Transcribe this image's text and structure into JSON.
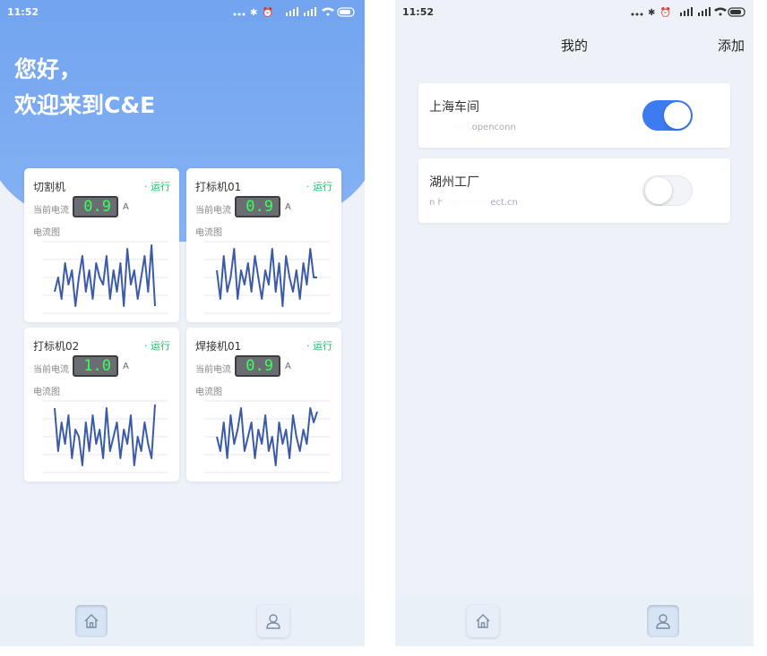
{
  "home": {
    "status_time": "11:52",
    "status_icons": "... ✱ ⏰ 📶 📶 ▭",
    "greeting_line1": "您好，",
    "greeting_line2": "欢迎来到C&E",
    "machines": [
      {
        "name": "切割机",
        "status": "· 运行",
        "current_label": "当前电流",
        "current": "0.9",
        "unit": "A",
        "chart_label": "电流图",
        "wave": [
          0.3,
          0.5,
          0.2,
          0.7,
          0.4,
          0.6,
          0.1,
          0.5,
          0.8,
          0.3,
          0.6,
          0.2,
          0.7,
          0.5,
          0.4,
          0.8,
          0.2,
          0.6,
          0.3,
          0.7,
          0.1,
          0.9,
          0.4,
          0.6,
          0.2,
          0.5,
          0.8,
          0.3,
          0.95,
          0.1
        ]
      },
      {
        "name": "打标机01",
        "status": "· 运行",
        "current_label": "当前电流",
        "current": "0.9",
        "unit": "A",
        "chart_label": "电流图",
        "wave": [
          0.6,
          0.2,
          0.8,
          0.3,
          0.5,
          0.9,
          0.2,
          0.6,
          0.4,
          0.7,
          0.3,
          0.8,
          0.5,
          0.2,
          0.6,
          0.4,
          0.9,
          0.3,
          0.7,
          0.1,
          0.8,
          0.5,
          0.3,
          0.6,
          0.2,
          0.7,
          0.4,
          0.9,
          0.5,
          0.5
        ]
      },
      {
        "name": "打标机02",
        "status": "· 运行",
        "current_label": "当前电流",
        "current": "1.0",
        "unit": "A",
        "chart_label": "电流图",
        "wave": [
          0.9,
          0.3,
          0.7,
          0.4,
          0.8,
          0.2,
          0.6,
          0.5,
          0.1,
          0.7,
          0.3,
          0.8,
          0.4,
          0.6,
          0.2,
          0.9,
          0.3,
          0.5,
          0.7,
          0.2,
          0.6,
          0.4,
          0.8,
          0.1,
          0.5,
          0.3,
          0.7,
          0.4,
          0.2,
          0.95
        ]
      },
      {
        "name": "焊接机01",
        "status": "· 运行",
        "current_label": "当前电流",
        "current": "0.9",
        "unit": "A",
        "chart_label": "电流图",
        "wave": [
          0.5,
          0.3,
          0.7,
          0.2,
          0.8,
          0.4,
          0.6,
          0.9,
          0.3,
          0.5,
          0.7,
          0.2,
          0.6,
          0.4,
          0.8,
          0.3,
          0.5,
          0.1,
          0.7,
          0.4,
          0.6,
          0.2,
          0.8,
          0.5,
          0.3,
          0.6,
          0.4,
          0.9,
          0.7,
          0.85
        ]
      }
    ]
  },
  "mine": {
    "status_time": "11:52",
    "status_icons": "... ✱ ⏰ 📶 📶 ▭",
    "title": "我的",
    "add_label": "添加",
    "workshops": [
      {
        "name": "上海车间",
        "host": "red.openconn",
        "enabled": true
      },
      {
        "name": "湖州工厂",
        "host": "n  h.openconnect.cn",
        "enabled": false
      }
    ]
  },
  "colors": {
    "accent": "#3d7bf0",
    "header": "#6fa1ee",
    "run_green": "#27b86a",
    "lcd_green": "#3aff5a",
    "wave": "#3b5aa8"
  }
}
